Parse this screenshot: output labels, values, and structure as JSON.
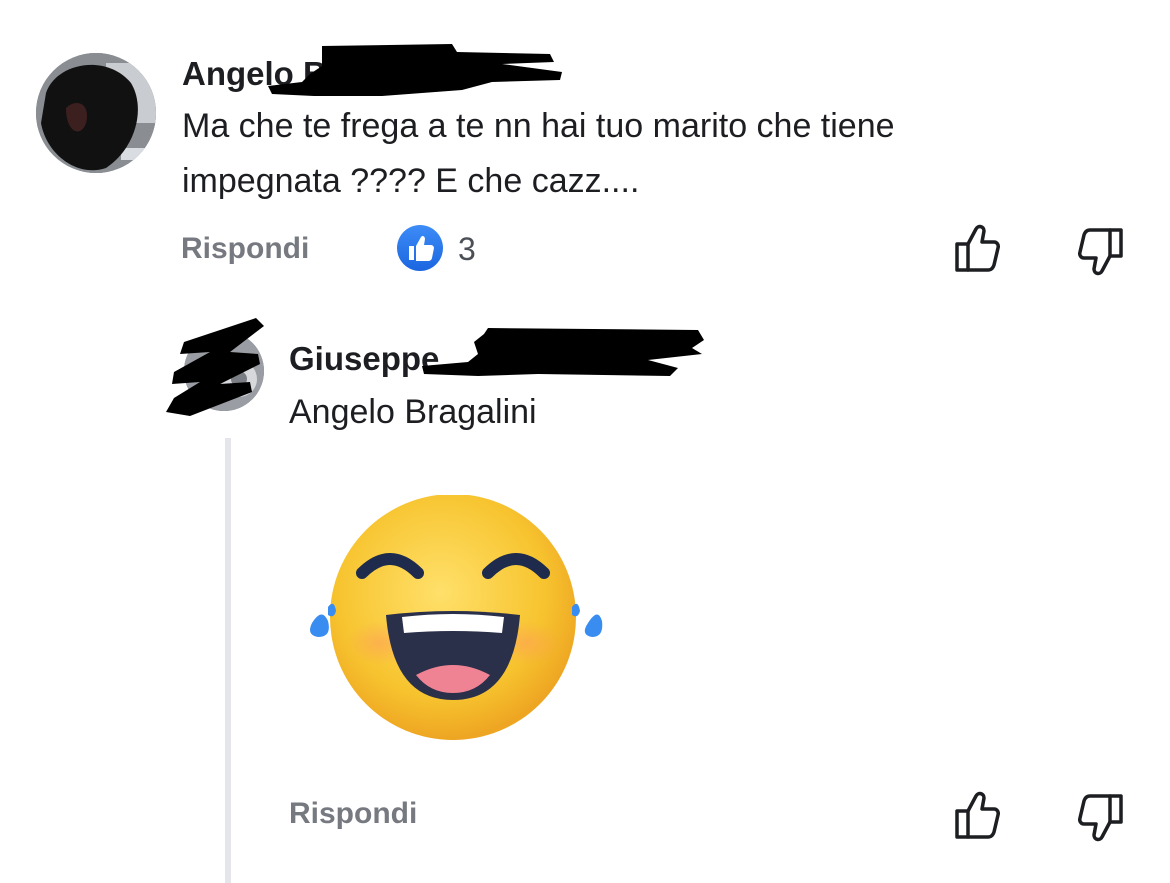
{
  "comment": {
    "author": "Angelo B",
    "text": "Ma che te frega a te nn hai tuo marito che tiene impegnata ???? E che cazz....",
    "reply_label": "Rispondi",
    "reactions_count": "3"
  },
  "reply": {
    "author": "Giuseppe",
    "text": "Angelo Bragalini",
    "reply_label": "Rispondi"
  },
  "colors": {
    "like_blue": "#1b66e0",
    "muted_text": "#767a80",
    "thread_line": "#e4e6eb"
  }
}
